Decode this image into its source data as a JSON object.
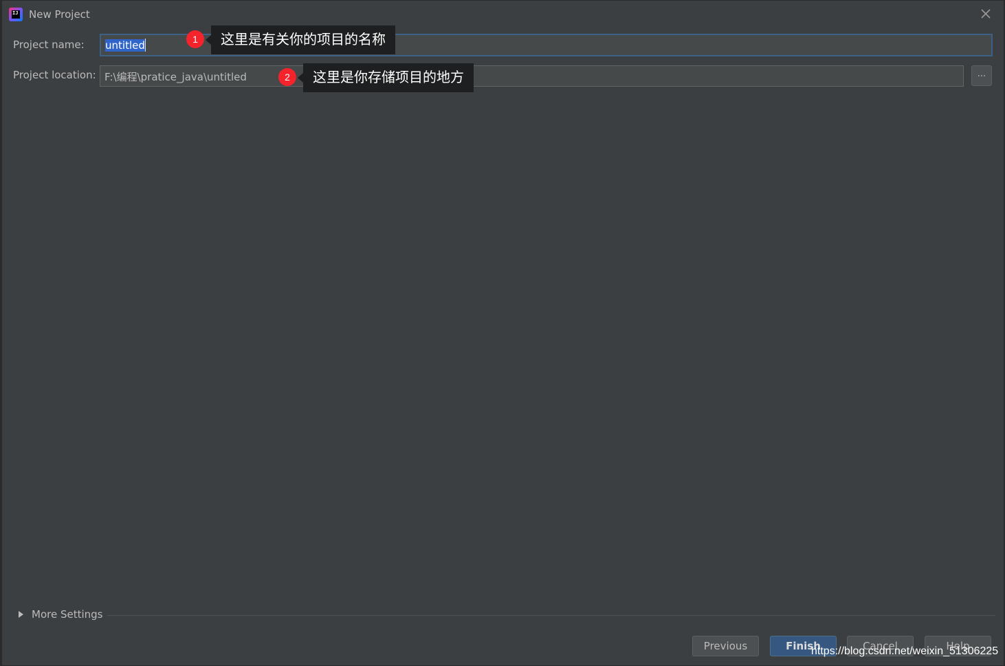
{
  "window": {
    "title": "New Project",
    "app_icon_text": "IJ"
  },
  "form": {
    "name_label": "Project name:",
    "name_value": "untitled",
    "location_label": "Project location:",
    "location_value": "F:\\编程\\pratice_java\\untitled",
    "browse_label": "..."
  },
  "callouts": [
    {
      "number": "1",
      "text": "这里是有关你的项目的名称"
    },
    {
      "number": "2",
      "text": "这里是你存储项目的地方"
    }
  ],
  "more_settings": {
    "label": "More Settings"
  },
  "buttons": {
    "previous": "Previous",
    "finish": "Finish",
    "cancel": "Cancel",
    "help": "Help"
  },
  "watermark": "https://blog.csdn.net/weixin_51306225",
  "colors": {
    "background": "#3c3f41",
    "field": "#45494a",
    "focus_border": "#3d6185",
    "selection": "#2f65ca",
    "badge": "#f5242c",
    "default_button": "#365880"
  }
}
